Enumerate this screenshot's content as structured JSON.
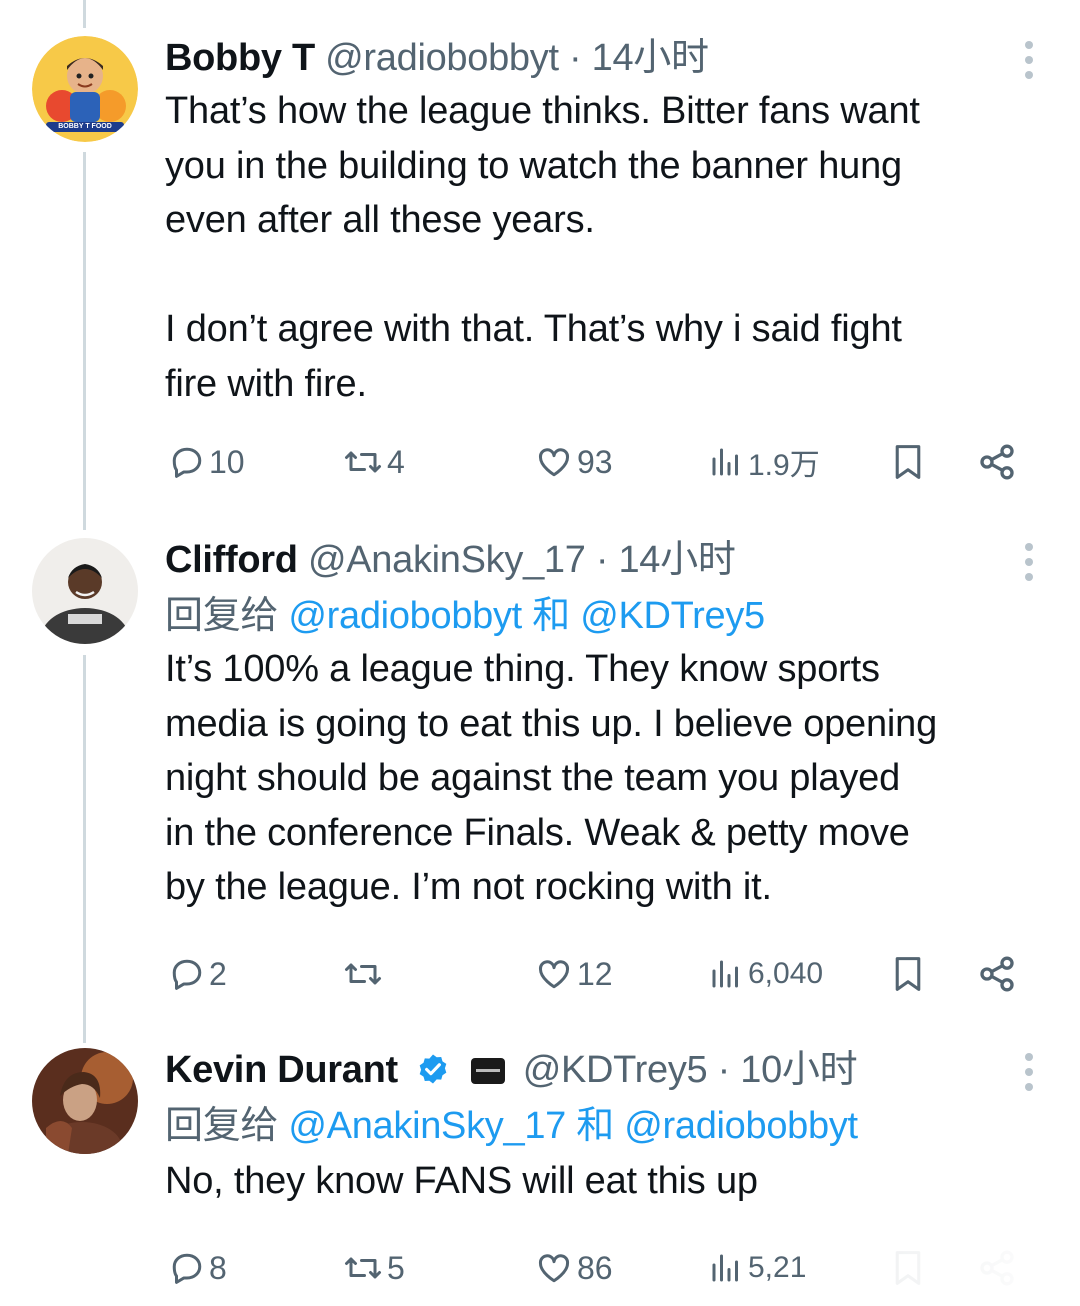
{
  "tweets": [
    {
      "name": "Bobby T",
      "handle": "@radiobobbyt",
      "separator": "·",
      "time": "14小时",
      "avatar_icon": "cartoon-avatar-icon",
      "avatar_label": "BOBBY T FOOD",
      "body": "That’s how the league thinks. Bitter fans want\nyou in the building to watch the banner hung\neven after all these years.\n\nI don’t agree with that. That’s why i said fight\nfire with fire.",
      "replies": "10",
      "retweets": "4",
      "likes": "93",
      "views": "1.9万"
    },
    {
      "name": "Clifford",
      "handle": "@AnakinSky_17",
      "separator": "·",
      "time": "14小时",
      "avatar_icon": "person-photo-avatar-icon",
      "reply_prefix": "回复给",
      "reply_mention_1": "@radiobobbyt",
      "reply_and": "和",
      "reply_mention_2": "@KDTrey5",
      "body": "It’s 100% a league thing. They know sports\nmedia is going to eat this up. I believe opening\nnight should be against the team you played\nin the conference Finals. Weak & petty move\nby the league. I’m not rocking with it.",
      "replies": "2",
      "retweets": "",
      "likes": "12",
      "views": "6,040"
    },
    {
      "name": "Kevin Durant",
      "handle": "@KDTrey5",
      "separator": "·",
      "time": "10小时",
      "avatar_icon": "character-avatar-icon",
      "verified_icon": "verified-badge-icon",
      "affiliate_icon": "affiliate-badge-icon",
      "reply_prefix": "回复给",
      "reply_mention_1": "@AnakinSky_17",
      "reply_and": "和",
      "reply_mention_2": "@radiobobbyt",
      "body": "No, they know FANS will eat this up",
      "replies": "8",
      "retweets": "5",
      "likes": "86",
      "views": "5,21"
    }
  ],
  "colors": {
    "text": "#0f1419",
    "secondary": "#536471",
    "mention": "#1d9bf0",
    "verified": "#1d9bf0",
    "thread_line": "#cfd9de"
  }
}
